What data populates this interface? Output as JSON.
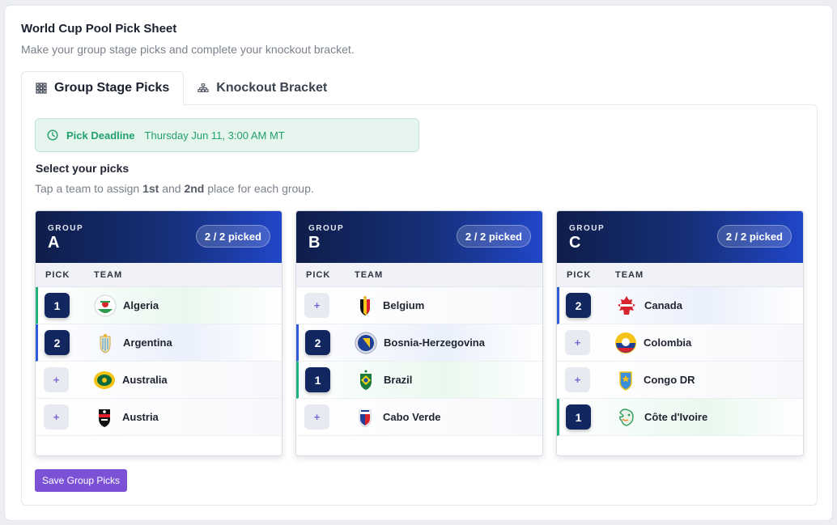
{
  "header": {
    "title": "World Cup Pool Pick Sheet",
    "subtitle": "Make your group stage picks and complete your knockout bracket."
  },
  "tabs": [
    {
      "label": "Group Stage Picks",
      "icon": "grid-icon",
      "active": true
    },
    {
      "label": "Knockout Bracket",
      "icon": "bracket-icon",
      "active": false
    }
  ],
  "deadline": {
    "label": "Pick Deadline",
    "value": "Thursday Jun 11, 3:00 AM MT",
    "icon": "clock-icon"
  },
  "instructions": {
    "title": "Select your picks",
    "text_before": "Tap a team to assign ",
    "first": "1st",
    "text_mid": " and ",
    "second": "2nd",
    "text_after": " place for each group."
  },
  "columns": {
    "pick": "PICK",
    "team": "TEAM"
  },
  "groups": [
    {
      "label": "GROUP",
      "letter": "A",
      "badge": "2 / 2 picked",
      "teams": [
        {
          "name": "Algeria",
          "pick": "1"
        },
        {
          "name": "Argentina",
          "pick": "2"
        },
        {
          "name": "Australia",
          "pick": "+"
        },
        {
          "name": "Austria",
          "pick": "+"
        }
      ]
    },
    {
      "label": "GROUP",
      "letter": "B",
      "badge": "2 / 2 picked",
      "teams": [
        {
          "name": "Belgium",
          "pick": "+"
        },
        {
          "name": "Bosnia-Herzegovina",
          "pick": "2"
        },
        {
          "name": "Brazil",
          "pick": "1"
        },
        {
          "name": "Cabo Verde",
          "pick": "+"
        }
      ]
    },
    {
      "label": "GROUP",
      "letter": "C",
      "badge": "2 / 2 picked",
      "teams": [
        {
          "name": "Canada",
          "pick": "2"
        },
        {
          "name": "Colombia",
          "pick": "+"
        },
        {
          "name": "Congo DR",
          "pick": "+"
        },
        {
          "name": "Côte d'Ivoire",
          "pick": "1"
        }
      ]
    }
  ],
  "save_button": "Save Group Picks",
  "colors": {
    "header_dark": "#0f1d4a",
    "header_light": "#2146c9",
    "first_place": "#21b27a",
    "second_place": "#2f5bd8",
    "save_button": "#7b52d6",
    "deadline": "#22a06b"
  }
}
